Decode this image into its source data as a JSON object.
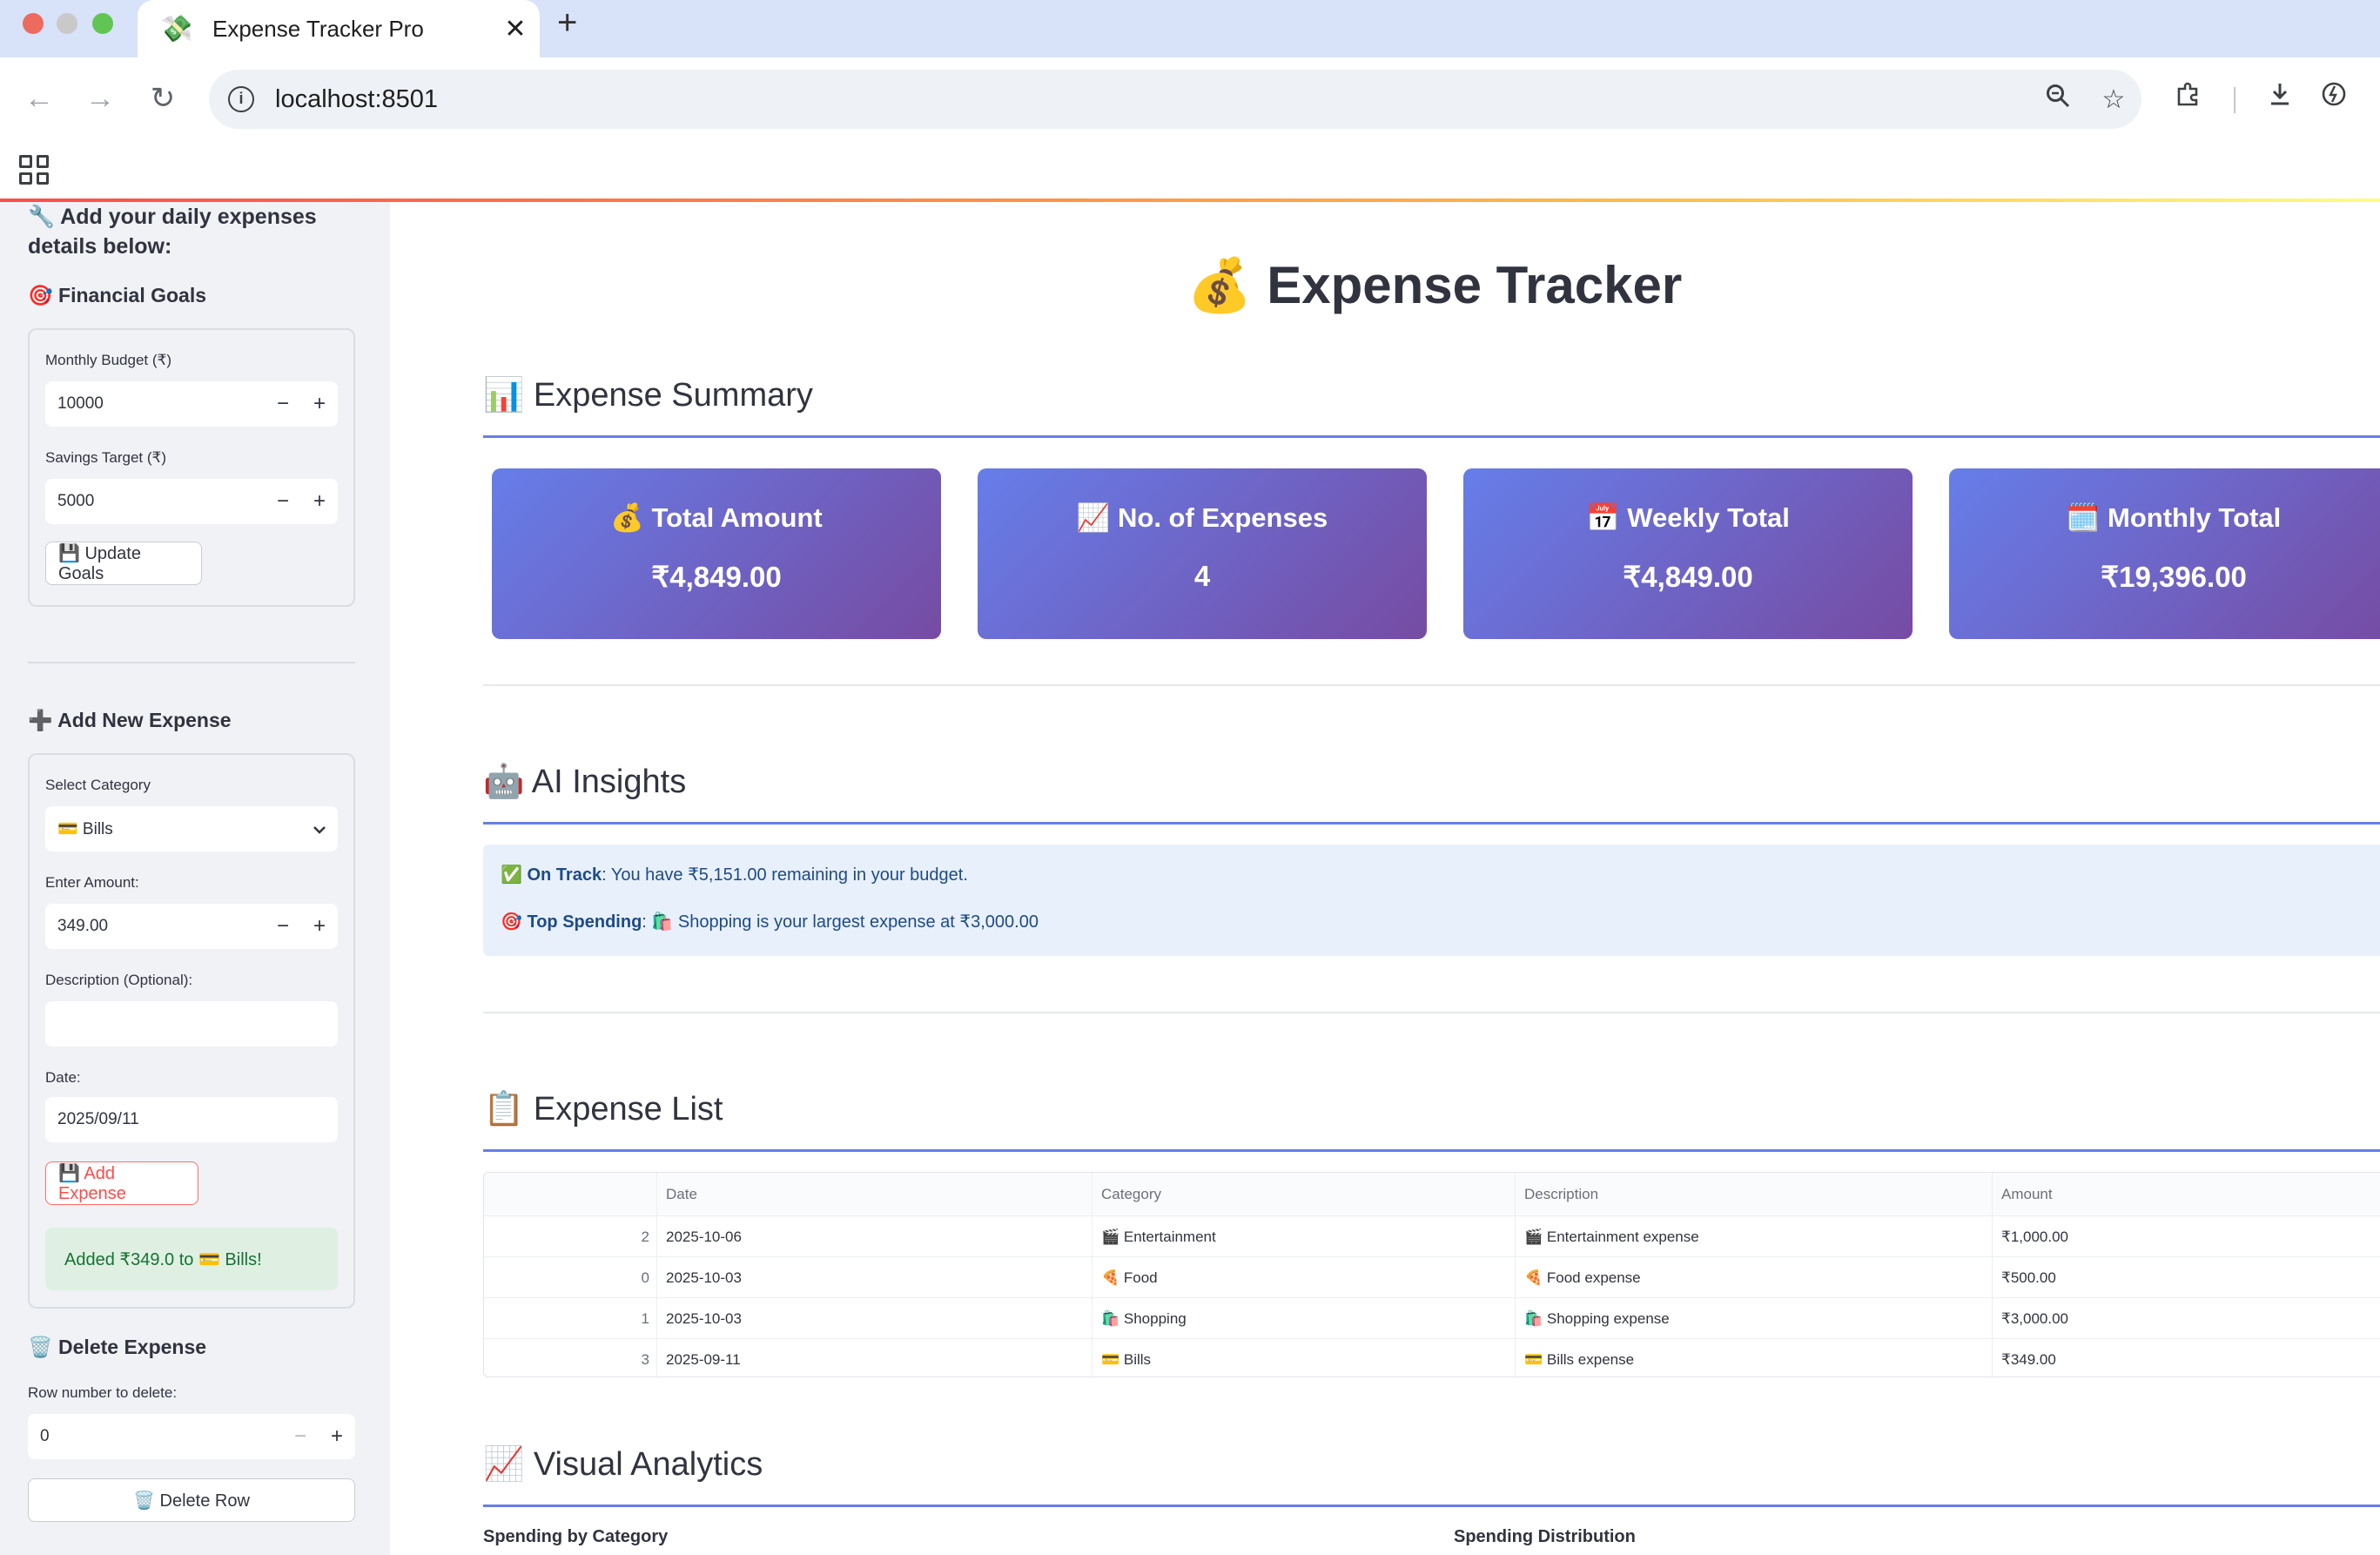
{
  "browser": {
    "tab_title": "Expense Tracker Pro",
    "tab_favicon": "💸",
    "url": "localhost:8501"
  },
  "sidebar": {
    "intro": "🔧 Add your daily expenses details below:",
    "goals_heading": "🎯 Financial Goals",
    "budget_label": "Monthly Budget (₹)",
    "budget_value": "10000",
    "savings_label": "Savings Target (₹)",
    "savings_value": "5000",
    "update_goals_label": "💾 Update Goals",
    "add_heading": "➕ Add New Expense",
    "category_label": "Select Category",
    "category_value": "💳 Bills",
    "amount_label": "Enter Amount:",
    "amount_value": "349.00",
    "description_label": "Description (Optional):",
    "description_value": "",
    "date_label": "Date:",
    "date_value": "2025/09/11",
    "add_button_label": "💾 Add Expense",
    "success_message": "Added ₹349.0 to 💳 Bills!",
    "delete_heading": "🗑️ Delete Expense",
    "row_number_label": "Row number to delete:",
    "row_number_value": "0",
    "delete_button_label": "🗑️ Delete Row",
    "stepper_minus": "−",
    "stepper_plus": "+"
  },
  "main": {
    "title": "💰 Expense Tracker",
    "summary_heading": "📊 Expense Summary",
    "cards": [
      {
        "title": "💰 Total Amount",
        "value": "₹4,849.00"
      },
      {
        "title": "📈 No. of Expenses",
        "value": "4"
      },
      {
        "title": "📅 Weekly Total",
        "value": "₹4,849.00"
      },
      {
        "title": "🗓️ Monthly Total",
        "value": "₹19,396.00"
      }
    ],
    "insights_heading": "🤖 AI Insights",
    "insights": [
      {
        "icon": "✅",
        "label": "On Track",
        "text": ": You have ₹5,151.00 remaining in your budget."
      },
      {
        "icon": "🎯",
        "label": "Top Spending",
        "text": ": 🛍️ Shopping is your largest expense at ₹3,000.00"
      }
    ],
    "list_heading": "📋 Expense List",
    "table": {
      "columns": [
        "",
        "Date",
        "Category",
        "Description",
        "Amount"
      ],
      "rows": [
        {
          "index": "2",
          "date": "2025-10-06",
          "category": "🎬 Entertainment",
          "description": "🎬 Entertainment expense",
          "amount": "₹1,000.00"
        },
        {
          "index": "0",
          "date": "2025-10-03",
          "category": "🍕 Food",
          "description": "🍕 Food expense",
          "amount": "₹500.00"
        },
        {
          "index": "1",
          "date": "2025-10-03",
          "category": "🛍️ Shopping",
          "description": "🛍️ Shopping expense",
          "amount": "₹3,000.00"
        },
        {
          "index": "3",
          "date": "2025-09-11",
          "category": "💳 Bills",
          "description": "💳 Bills expense",
          "amount": "₹349.00"
        }
      ]
    },
    "analytics_heading": "📈 Visual Analytics",
    "chart1_title": "Spending by Category",
    "chart2_title": "Spending Distribution"
  },
  "colors": {
    "accent": "#667eea",
    "card_gradient_end": "#764ba2",
    "primary": "#ff4b4b",
    "sidebar_bg": "#f0f2f6"
  }
}
